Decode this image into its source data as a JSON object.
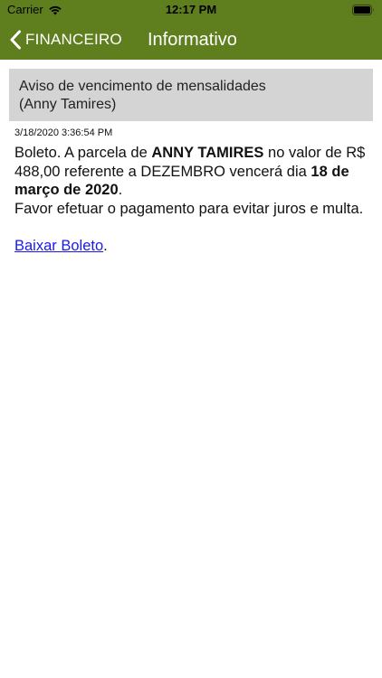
{
  "status_bar": {
    "carrier": "Carrier",
    "time": "12:17 PM",
    "wifi_icon": "wifi-icon",
    "battery_icon": "battery-icon"
  },
  "nav": {
    "back_label": "FINANCEIRO",
    "back_icon": "chevron-left-icon",
    "title": "Informativo",
    "color": "#5f7f1f"
  },
  "notice": {
    "title_line1": "Aviso de vencimento de mensalidades",
    "title_line2": "(Anny Tamires)",
    "timestamp": "3/18/2020 3:36:54 PM",
    "message": {
      "part1": "Boleto. A parcela de ",
      "name": "ANNY TAMIRES",
      "part2": " no valor de R$ 488,00 referente a DEZEMBRO vencerá dia ",
      "due_date": "18 de março de 2020",
      "part3": ".",
      "line2": "Favor efetuar o pagamento para evitar juros e multa."
    },
    "link_label": "Baixar Boleto",
    "link_suffix": ".",
    "link_color": "#1a1aee"
  }
}
